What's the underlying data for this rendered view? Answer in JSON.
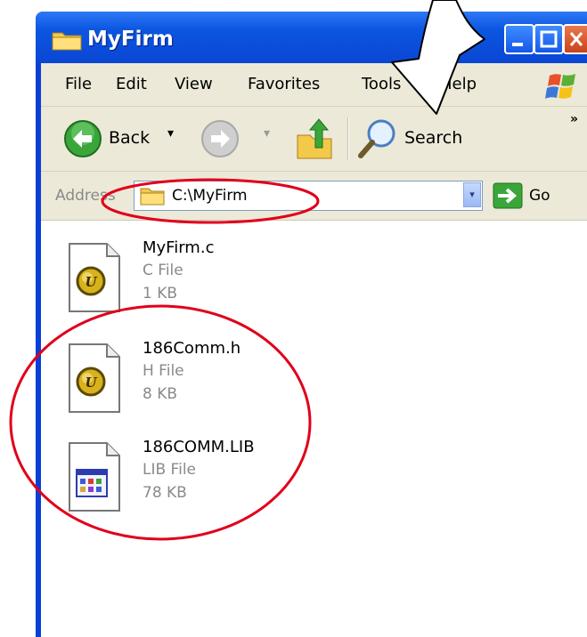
{
  "window": {
    "title": "MyFirm",
    "menu": [
      "File",
      "Edit",
      "View",
      "Favorites",
      "Tools",
      "Help"
    ],
    "toolbar": {
      "back_label": "Back",
      "search_label": "Search",
      "more_chevron": "»",
      "dropdown_glyph": "▾"
    },
    "address": {
      "label": "Address",
      "value": "C:\\MyFirm",
      "go_label": "Go"
    }
  },
  "files": [
    {
      "name": "MyFirm.c",
      "type": "C File",
      "size": "1 KB",
      "icon": "ultraedit-doc-icon"
    },
    {
      "name": "186Comm.h",
      "type": "H File",
      "size": "8 KB",
      "icon": "ultraedit-doc-icon"
    },
    {
      "name": "186COMM.LIB",
      "type": "LIB File",
      "size": "78 KB",
      "icon": "lib-file-icon"
    }
  ],
  "colors": {
    "titlebar": "#0a46d4",
    "chrome": "#ece9d8",
    "annotation_red": "#e0001b"
  }
}
